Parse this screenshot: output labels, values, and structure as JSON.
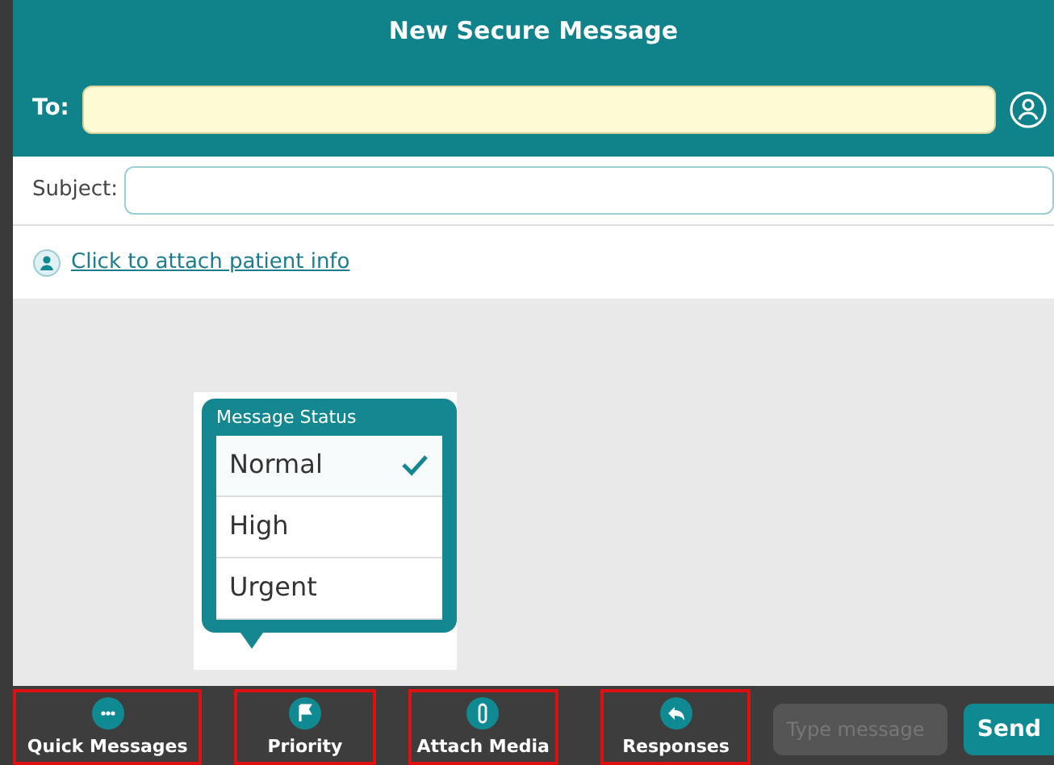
{
  "window": {
    "title": "New Secure Message"
  },
  "to": {
    "label": "To:"
  },
  "subject": {
    "label": "Subject:"
  },
  "attach_link": "Click to attach patient info",
  "status_menu": {
    "title": "Message Status",
    "items": [
      {
        "label": "Normal",
        "selected": true
      },
      {
        "label": "High",
        "selected": false
      },
      {
        "label": "Urgent",
        "selected": false
      }
    ]
  },
  "toolbar": {
    "buttons": [
      {
        "label": "Quick Messages",
        "kind": "chat",
        "highlighted": true
      },
      {
        "label": "Priority",
        "kind": "flag",
        "highlighted": true
      },
      {
        "label": "Attach Media",
        "kind": "clip",
        "highlighted": true
      },
      {
        "label": "Responses",
        "kind": "reply",
        "highlighted": true
      }
    ],
    "message": {
      "placeholder": "Type message"
    },
    "send": "Send"
  }
}
